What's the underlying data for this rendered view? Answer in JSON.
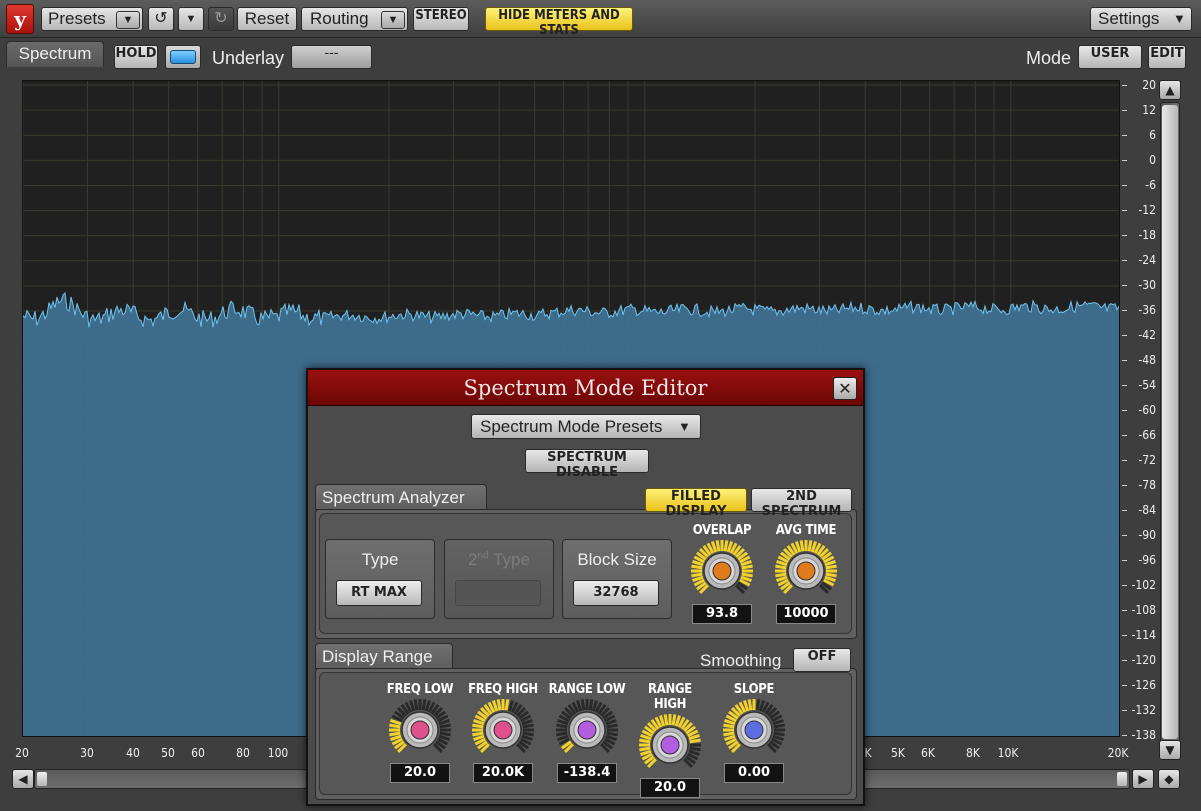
{
  "toolbar": {
    "logo": "y",
    "presets": "Presets",
    "reset": "Reset",
    "routing": "Routing",
    "stereo": "STEREO",
    "hide_meters": "HIDE METERS AND STATS",
    "settings": "Settings"
  },
  "spectrum_header": {
    "tab": "Spectrum",
    "hold": "HOLD",
    "underlay_label": "Underlay",
    "underlay_value": "---",
    "mode_label": "Mode",
    "mode_value": "USER",
    "edit": "EDIT"
  },
  "graph": {
    "y_ticks": [
      "20",
      "12",
      "6",
      "0",
      "-6",
      "-12",
      "-18",
      "-24",
      "-30",
      "-36",
      "-42",
      "-48",
      "-54",
      "-60",
      "-66",
      "-72",
      "-78",
      "-84",
      "-90",
      "-96",
      "-102",
      "-108",
      "-114",
      "-120",
      "-126",
      "-132",
      "-138"
    ],
    "x_ticks_left": [
      "20",
      "30",
      "40",
      "50",
      "60",
      "80",
      "100"
    ],
    "x_ticks_right": [
      "K",
      "5K",
      "6K",
      "8K",
      "10K",
      "20K"
    ],
    "fill_color": "#3f7090",
    "line_color": "#6ec4f2"
  },
  "dialog": {
    "title": "Spectrum Mode Editor",
    "presets": "Spectrum Mode Presets",
    "disable": "SPECTRUM DISABLE",
    "analyzer": {
      "tab": "Spectrum Analyzer",
      "filled_display": "FILLED DISPLAY",
      "second_spectrum": "2ND SPECTRUM",
      "type_label": "Type",
      "type_value": "RT MAX",
      "type2_label": "2nd Type",
      "block_label": "Block Size",
      "block_value": "32768",
      "overlap_label": "OVERLAP",
      "overlap_value": "93.8",
      "avg_label": "AVG TIME",
      "avg_value": "10000"
    },
    "display_range": {
      "tab": "Display Range",
      "smoothing_label": "Smoothing",
      "smoothing_value": "OFF",
      "knobs": [
        {
          "label": "FREQ LOW",
          "value": "20.0",
          "color": "#e0508a",
          "level": 0.25
        },
        {
          "label": "FREQ HIGH",
          "value": "20.0K",
          "color": "#e0508a",
          "level": 0.55
        },
        {
          "label": "RANGE LOW",
          "value": "-138.4",
          "color": "#b35ee0",
          "level": 0.05
        },
        {
          "label": "RANGE HIGH",
          "value": "20.0",
          "color": "#b35ee0",
          "level": 0.8
        },
        {
          "label": "SLOPE",
          "value": "0.00",
          "color": "#5a6ee0",
          "level": 0.5
        }
      ]
    }
  }
}
